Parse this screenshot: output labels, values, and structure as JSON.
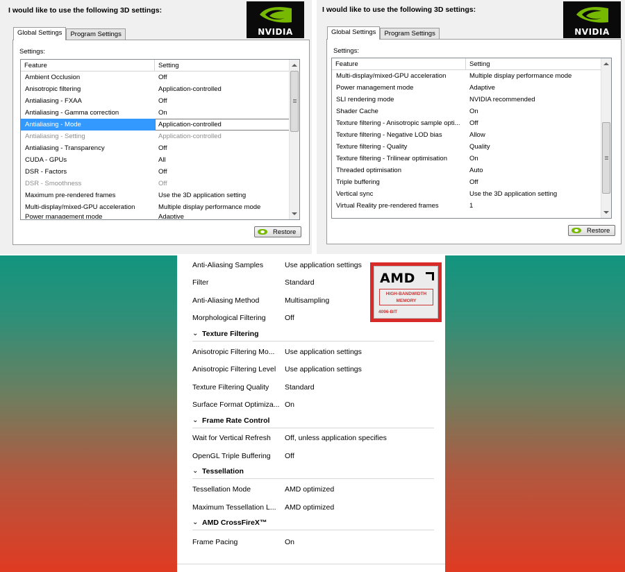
{
  "nvidia_left": {
    "heading": "I would like to use the following 3D settings:",
    "logo_text": "NVIDIA",
    "tabs": [
      "Global Settings",
      "Program Settings"
    ],
    "settings_label": "Settings:",
    "columns": [
      "Feature",
      "Setting"
    ],
    "rows": [
      {
        "feature": "Ambient Occlusion",
        "setting": "Off"
      },
      {
        "feature": "Anisotropic filtering",
        "setting": "Application-controlled"
      },
      {
        "feature": "Antialiasing - FXAA",
        "setting": "Off"
      },
      {
        "feature": "Antialiasing - Gamma correction",
        "setting": "On"
      },
      {
        "feature": "Antialiasing - Mode",
        "setting": "Application-controlled"
      },
      {
        "feature": "Antialiasing - Setting",
        "setting": "Application-controlled"
      },
      {
        "feature": "Antialiasing - Transparency",
        "setting": "Off"
      },
      {
        "feature": "CUDA - GPUs",
        "setting": "All"
      },
      {
        "feature": "DSR - Factors",
        "setting": "Off"
      },
      {
        "feature": "DSR - Smoothness",
        "setting": "Off"
      },
      {
        "feature": "Maximum pre-rendered frames",
        "setting": "Use the 3D application setting"
      },
      {
        "feature": "Multi-display/mixed-GPU acceleration",
        "setting": "Multiple display performance mode"
      },
      {
        "feature": "Power management mode",
        "setting": "Adaptive"
      }
    ],
    "restore_label": "Restore"
  },
  "nvidia_right": {
    "heading": "I would like to use the following 3D settings:",
    "logo_text": "NVIDIA",
    "tabs": [
      "Global Settings",
      "Program Settings"
    ],
    "settings_label": "Settings:",
    "columns": [
      "Feature",
      "Setting"
    ],
    "rows": [
      {
        "feature": "Multi-display/mixed-GPU acceleration",
        "setting": "Multiple display performance mode"
      },
      {
        "feature": "Power management mode",
        "setting": "Adaptive"
      },
      {
        "feature": "SLI rendering mode",
        "setting": "NVIDIA recommended"
      },
      {
        "feature": "Shader Cache",
        "setting": "On"
      },
      {
        "feature": "Texture filtering - Anisotropic sample opti...",
        "setting": "Off"
      },
      {
        "feature": "Texture filtering - Negative LOD bias",
        "setting": "Allow"
      },
      {
        "feature": "Texture filtering - Quality",
        "setting": "Quality"
      },
      {
        "feature": "Texture filtering - Trilinear optimisation",
        "setting": "On"
      },
      {
        "feature": "Threaded optimisation",
        "setting": "Auto"
      },
      {
        "feature": "Triple buffering",
        "setting": "Off"
      },
      {
        "feature": "Vertical sync",
        "setting": "Use the 3D application setting"
      },
      {
        "feature": "Virtual Reality pre-rendered frames",
        "setting": "1"
      }
    ],
    "restore_label": "Restore"
  },
  "amd": {
    "logo": {
      "brand": "AMD",
      "badge_line1": "HIGH-BANDWIDTH",
      "badge_line2": "MEMORY",
      "bits": "4096-BIT"
    },
    "rows_top": [
      {
        "key": "Anti-Aliasing Samples",
        "value": "Use application settings"
      },
      {
        "key": "Filter",
        "value": "Standard"
      },
      {
        "key": "Anti-Aliasing Method",
        "value": "Multisampling"
      },
      {
        "key": "Morphological Filtering",
        "value": "Off"
      }
    ],
    "section_texture": "Texture Filtering",
    "rows_texture": [
      {
        "key": "Anisotropic Filtering Mo...",
        "value": "Use application settings"
      },
      {
        "key": "Anisotropic Filtering Level",
        "value": "Use application settings"
      },
      {
        "key": "Texture Filtering Quality",
        "value": "Standard"
      },
      {
        "key": "Surface Format Optimiza...",
        "value": "On"
      }
    ],
    "section_frame": "Frame Rate Control",
    "rows_frame": [
      {
        "key": "Wait for Vertical Refresh",
        "value": "Off, unless application specifies"
      },
      {
        "key": "OpenGL Triple Buffering",
        "value": "Off"
      }
    ],
    "section_tess": "Tessellation",
    "rows_tess": [
      {
        "key": "Tessellation Mode",
        "value": "AMD optimized"
      },
      {
        "key": "Maximum Tessellation L...",
        "value": "AMD optimized"
      }
    ],
    "section_crossfire": "AMD CrossFireX™",
    "rows_crossfire": [
      {
        "key": "Frame Pacing",
        "value": "On"
      }
    ]
  }
}
